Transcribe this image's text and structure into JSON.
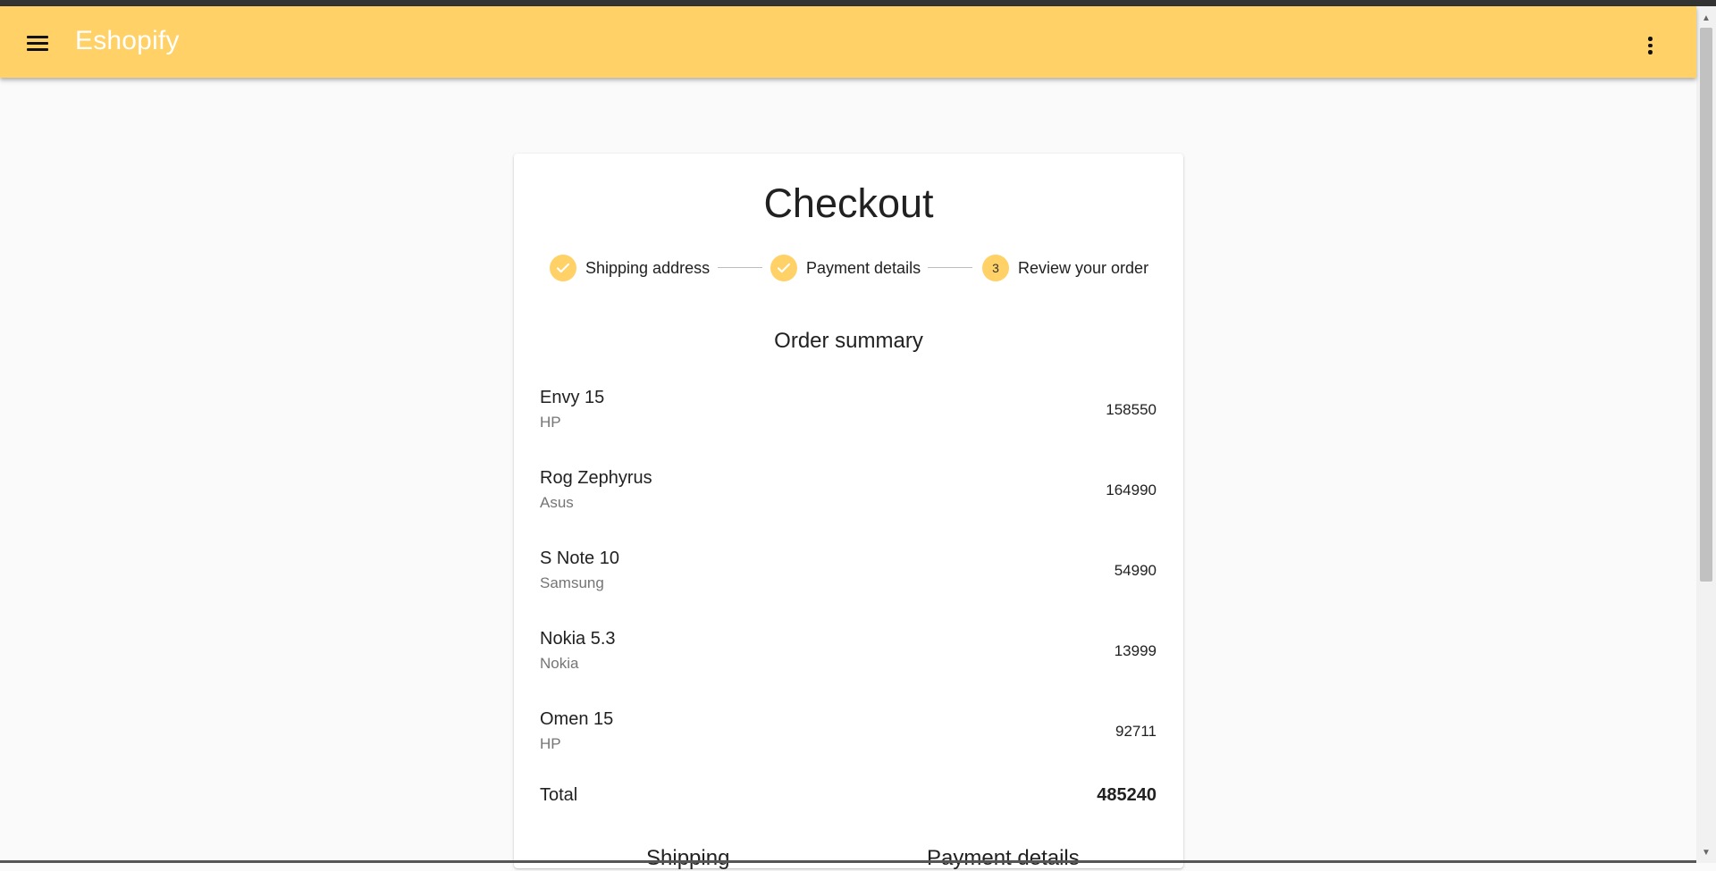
{
  "app": {
    "title": "Eshopify"
  },
  "colors": {
    "accent": "#ffd166",
    "background": "#fafafa",
    "card": "#ffffff"
  },
  "icons": {
    "menu": "menu-icon",
    "more": "more-vert-icon",
    "check": "check-icon"
  },
  "checkout": {
    "title": "Checkout",
    "steps": [
      {
        "label": "Shipping address",
        "state": "completed"
      },
      {
        "label": "Payment details",
        "state": "completed"
      },
      {
        "label": "Review your order",
        "state": "active",
        "number": "3"
      }
    ],
    "summary_title": "Order summary",
    "items": [
      {
        "name": "Envy 15",
        "brand": "HP",
        "price": "158550"
      },
      {
        "name": "Rog Zephyrus",
        "brand": "Asus",
        "price": "164990"
      },
      {
        "name": "S Note 10",
        "brand": "Samsung",
        "price": "54990"
      },
      {
        "name": "Nokia 5.3",
        "brand": "Nokia",
        "price": "13999"
      },
      {
        "name": "Omen 15",
        "brand": "HP",
        "price": "92711"
      }
    ],
    "total_label": "Total",
    "total_value": "485240",
    "shipping_heading": "Shipping",
    "payment_heading": "Payment details"
  }
}
